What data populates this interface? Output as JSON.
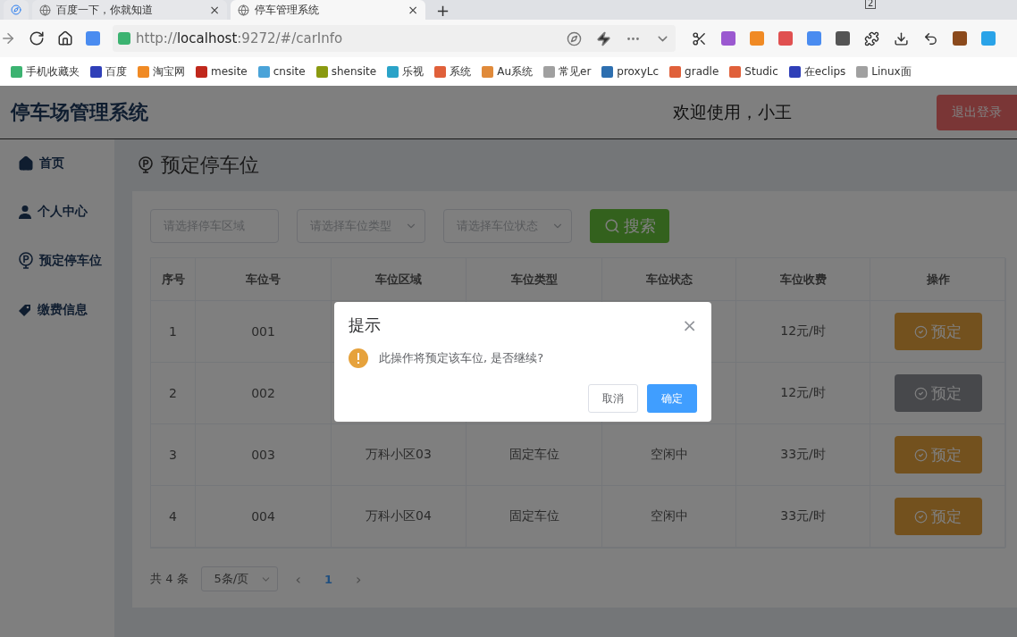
{
  "browser": {
    "tabs": [
      {
        "title": "百度一下，你就知道",
        "close": "×",
        "selected": false
      },
      {
        "title": "停车管理系统",
        "close": "×",
        "selected": true
      }
    ],
    "new_tab": "+",
    "window_badge": "2",
    "url": {
      "scheme": "http://",
      "host": "localhost",
      "path": ":9272/#/carInfo"
    },
    "bookmarks": [
      {
        "label": "手机收藏夹",
        "color": "#3cb371"
      },
      {
        "label": "百度",
        "color": "#2f3fb8"
      },
      {
        "label": "淘宝网",
        "color": "#f08a24"
      },
      {
        "label": "mesite",
        "color": "#c0281c"
      },
      {
        "label": "cnsite",
        "color": "#4aa3d8"
      },
      {
        "label": "shensite",
        "color": "#8a9a10"
      },
      {
        "label": "乐视",
        "color": "#2aa3c8"
      },
      {
        "label": "系统",
        "color": "#e0603a"
      },
      {
        "label": "Au系统",
        "color": "#e08a3a"
      },
      {
        "label": "常见er",
        "color": "#a0a0a0"
      },
      {
        "label": "proxyLc",
        "color": "#2d6fb0"
      },
      {
        "label": "gradle",
        "color": "#e0603a"
      },
      {
        "label": "Studic",
        "color": "#e0603a"
      },
      {
        "label": "在eclips",
        "color": "#2f3fb8"
      },
      {
        "label": "Linux面",
        "color": "#a0a0a0"
      }
    ]
  },
  "app": {
    "title": "停车场管理系统",
    "welcome": "欢迎使用，小王",
    "logout": "退出登录",
    "menu": [
      {
        "label": "首页",
        "kind": "home"
      },
      {
        "label": "个人中心",
        "kind": "user"
      },
      {
        "label": "预定停车位",
        "kind": "parking"
      },
      {
        "label": "缴费信息",
        "kind": "tag"
      }
    ],
    "page_title": "预定停车位",
    "filters": [
      {
        "kind": "input",
        "placeholder": "请选择停车区域"
      },
      {
        "kind": "select",
        "placeholder": "请选择车位类型"
      },
      {
        "kind": "select",
        "placeholder": "请选择车位状态"
      }
    ],
    "search": "搜索",
    "table": {
      "columns": [
        "序号",
        "车位号",
        "车位区域",
        "车位类型",
        "车位状态",
        "车位收费",
        "操作"
      ],
      "rows": [
        {
          "index": "1",
          "number": "001",
          "fee": "12元/时",
          "action": {
            "label": "预定",
            "disabled": false
          }
        },
        {
          "index": "2",
          "number": "002",
          "fee": "12元/时",
          "action": {
            "label": "预定",
            "disabled": true
          }
        },
        {
          "index": "3",
          "number": "003",
          "area": "万科小区03",
          "type": "固定车位",
          "status": "空闲中",
          "fee": "33元/时",
          "action": {
            "label": "预定",
            "disabled": false
          }
        },
        {
          "index": "4",
          "number": "004",
          "area": "万科小区04",
          "type": "固定车位",
          "status": "空闲中",
          "fee": "33元/时",
          "action": {
            "label": "预定",
            "disabled": false
          }
        }
      ]
    },
    "pagination": {
      "total": "共 4 条",
      "page_size": "5条/页",
      "prev": "‹",
      "next": "›",
      "pages": [
        {
          "label": "1",
          "selected": true
        }
      ]
    }
  },
  "dialog": {
    "title": "提示",
    "close": "×",
    "message": "此操作将预定该车位, 是否继续?",
    "cancel": "取消",
    "confirm": "确定"
  }
}
